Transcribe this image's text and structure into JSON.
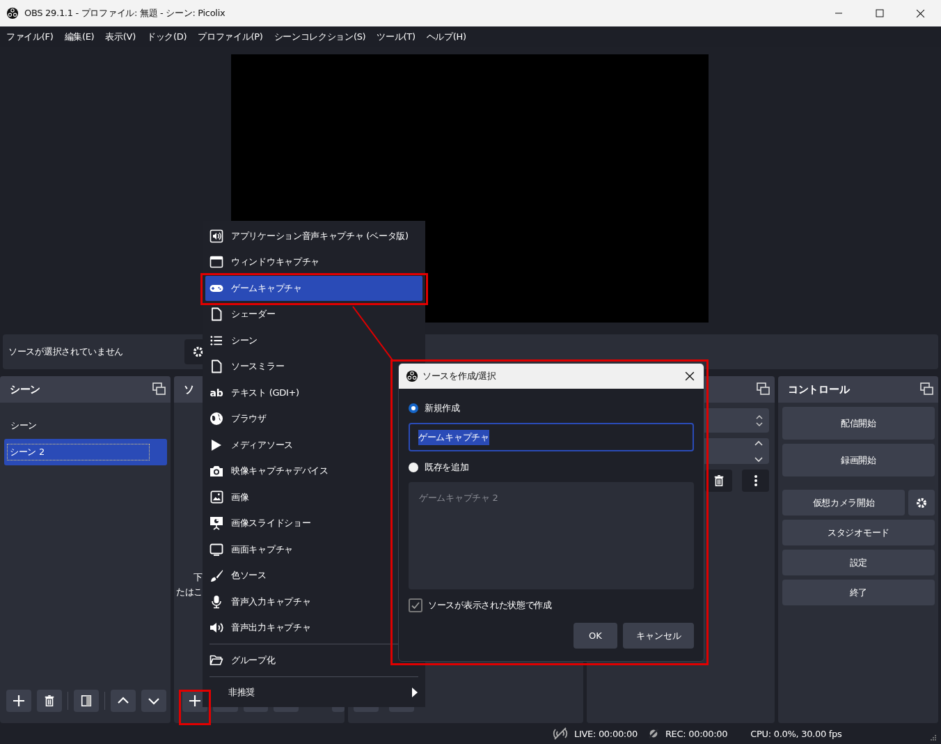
{
  "window": {
    "title": "OBS 29.1.1 - プロファイル: 無題 - シーン: Picolix"
  },
  "menu_bar": [
    "ファイル(F)",
    "編集(E)",
    "表示(V)",
    "ドック(D)",
    "プロファイル(P)",
    "シーンコレクション(S)",
    "ツール(T)",
    "ヘルプ(H)"
  ],
  "context_bar": {
    "text": "ソースが選択されていません"
  },
  "scenes_dock": {
    "title": "シーン",
    "items": [
      {
        "label": "シーン",
        "selected": false
      },
      {
        "label": "シーン 2",
        "selected": true
      }
    ]
  },
  "sources_dock": {
    "title": "ソ",
    "hint_lines": [
      "下",
      "たはこ"
    ]
  },
  "controls_dock": {
    "title": "コントロール",
    "buttons": [
      {
        "label": "配信開始",
        "kind": "plain"
      },
      {
        "label": "録画開始",
        "kind": "plain"
      },
      {
        "label": "仮想カメラ開始",
        "kind": "with-settings"
      },
      {
        "label": "スタジオモード",
        "kind": "plain"
      },
      {
        "label": "設定",
        "kind": "plain"
      },
      {
        "label": "終了",
        "kind": "plain"
      }
    ]
  },
  "add_source_menu": {
    "items": [
      {
        "kind": "item",
        "label": "アプリケーション音声キャプチャ (ベータ版)",
        "selected": false
      },
      {
        "kind": "item",
        "label": "ウィンドウキャプチャ",
        "selected": false
      },
      {
        "kind": "item",
        "label": "ゲームキャプチャ",
        "selected": true
      },
      {
        "kind": "item",
        "label": "シェーダー",
        "selected": false
      },
      {
        "kind": "item",
        "label": "シーン",
        "selected": false
      },
      {
        "kind": "item",
        "label": "ソースミラー",
        "selected": false
      },
      {
        "kind": "item",
        "label": "テキスト (GDI+)",
        "icon_text": "ab",
        "selected": false
      },
      {
        "kind": "item",
        "label": "ブラウザ",
        "selected": false
      },
      {
        "kind": "item",
        "label": "メディアソース",
        "selected": false
      },
      {
        "kind": "item",
        "label": "映像キャプチャデバイス",
        "selected": false
      },
      {
        "kind": "item",
        "label": "画像",
        "selected": false
      },
      {
        "kind": "item",
        "label": "画像スライドショー",
        "selected": false
      },
      {
        "kind": "item",
        "label": "画面キャプチャ",
        "selected": false
      },
      {
        "kind": "item",
        "label": "色ソース",
        "selected": false
      },
      {
        "kind": "item",
        "label": "音声入力キャプチャ",
        "selected": false
      },
      {
        "kind": "item",
        "label": "音声出力キャプチャ",
        "selected": false
      },
      {
        "kind": "separator"
      },
      {
        "kind": "item",
        "label": "グループ化",
        "selected": false
      },
      {
        "kind": "separator"
      },
      {
        "kind": "submenu",
        "label": "非推奨",
        "selected": false
      }
    ]
  },
  "dialog": {
    "title": "ソースを作成/選択",
    "options": [
      {
        "label": "新規作成",
        "selected": true
      },
      {
        "label": "既存を追加",
        "selected": false
      }
    ],
    "name_value": "ゲームキャプチャ",
    "existing": [
      "ゲームキャプチャ 2"
    ],
    "visible_checkbox": {
      "label": "ソースが表示された状態で作成",
      "checked": true
    },
    "buttons": [
      "OK",
      "キャンセル"
    ]
  },
  "status_bar": {
    "live": "LIVE: 00:00:00",
    "rec": "REC: 00:00:00",
    "cpu": "CPU: 0.0%, 30.00 fps"
  }
}
